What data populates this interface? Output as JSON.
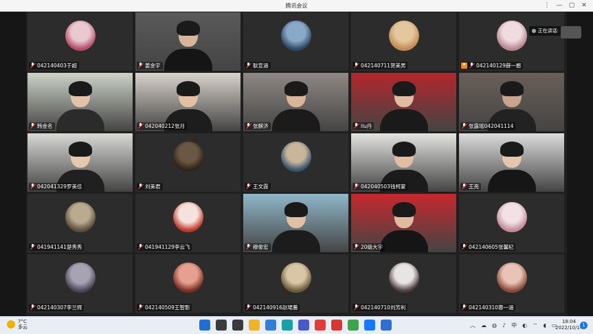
{
  "window": {
    "title": "腾讯会议"
  },
  "speaking_status": "正在讲话:",
  "participants": [
    {
      "name": "042140403于超",
      "kind": "avatar",
      "avatar_colors": [
        "#e8c9cf",
        "#b44d6b"
      ]
    },
    {
      "name": "姜金宇",
      "kind": "video",
      "bg": "#5a5a5a",
      "skin": "#d7b49a",
      "cloth": "#151515"
    },
    {
      "name": "耿宣涵",
      "kind": "avatar",
      "avatar_colors": [
        "#8aa9c9",
        "#2f4a66"
      ]
    },
    {
      "name": "042140711贺美男",
      "kind": "avatar",
      "avatar_colors": [
        "#e5c79d",
        "#c28a55"
      ]
    },
    {
      "name": "042140129薛一憨",
      "kind": "avatar",
      "avatar_colors": [
        "#f0dce0",
        "#b8878f"
      ],
      "host": true
    },
    {
      "name": "韩金名",
      "kind": "video",
      "bg": "#cdd3c7",
      "skin": "#e2c2a8",
      "cloth": "#2b2b2b"
    },
    {
      "name": "042040212张月",
      "kind": "video",
      "bg": "#d8d3cc",
      "skin": "#e2c0a2",
      "cloth": "#1d1d1d"
    },
    {
      "name": "张麒济",
      "kind": "video",
      "bg": "#8f8884",
      "skin": "#d9b59a",
      "cloth": "#1b1b1b"
    },
    {
      "name": "liu丹",
      "kind": "video",
      "bg": "#b3262b",
      "skin": "#e0bca0",
      "cloth": "#1a1a1a"
    },
    {
      "name": "张露瑶042041114",
      "kind": "video",
      "bg": "#6a5f58",
      "skin": "#caa38c",
      "cloth": "#222222"
    },
    {
      "name": "042041329罗美佳",
      "kind": "video",
      "bg": "#d9d9d6",
      "skin": "#e6c8ae",
      "cloth": "#202020"
    },
    {
      "name": "刘美君",
      "kind": "avatar",
      "avatar_colors": [
        "#6b5844",
        "#2e2419"
      ]
    },
    {
      "name": "王文霞",
      "kind": "avatar",
      "avatar_colors": [
        "#c9b69a",
        "#3a5570"
      ]
    },
    {
      "name": "042040503钱柯蒙",
      "kind": "video",
      "bg": "#e3e3e0",
      "skin": "#e1bea2",
      "cloth": "#1b1b1b"
    },
    {
      "name": "王亮",
      "kind": "video",
      "bg": "#dcdcdc",
      "skin": "#e5c6ad",
      "cloth": "#161616"
    },
    {
      "name": "041941141楚秀秀",
      "kind": "avatar",
      "avatar_colors": [
        "#b9ab8f",
        "#5c4f3b"
      ]
    },
    {
      "name": "041941129李云飞",
      "kind": "avatar",
      "avatar_colors": [
        "#f4e3dc",
        "#c0392b"
      ]
    },
    {
      "name": "穆俊宏",
      "kind": "video",
      "bg": "#8fb7c9",
      "skin": "#e0bfa5",
      "cloth": "#1c1c1c"
    },
    {
      "name": "20级大宇",
      "kind": "video",
      "bg": "#c7282e",
      "skin": "#e0bb9e",
      "cloth": "#151515"
    },
    {
      "name": "042140605张馨杞",
      "kind": "avatar",
      "avatar_colors": [
        "#f2e2e6",
        "#c48a98"
      ]
    },
    {
      "name": "042140307李兰辉",
      "kind": "avatar",
      "avatar_colors": [
        "#a7a3b3",
        "#4a4558"
      ]
    },
    {
      "name": "042140509王智影",
      "kind": "avatar",
      "avatar_colors": [
        "#e6a08f",
        "#7a2e26"
      ]
    },
    {
      "name": "042140916赵珺蕙",
      "kind": "avatar",
      "avatar_colors": [
        "#d8c6a6",
        "#6d5b3d"
      ]
    },
    {
      "name": "042140710刘芳利",
      "kind": "avatar",
      "avatar_colors": [
        "#e9e4e4",
        "#4b3f3f"
      ]
    },
    {
      "name": "042140310蓉一涵",
      "kind": "avatar",
      "avatar_colors": [
        "#e9c3b6",
        "#8a4a3c"
      ]
    }
  ],
  "taskbar": {
    "weather_temp": "7°C",
    "weather_desc": "多云",
    "apps": [
      {
        "icon": "windows-start-icon",
        "color": "#1f6fd1"
      },
      {
        "icon": "search-icon",
        "color": "#3b3b3b"
      },
      {
        "icon": "task-view-icon",
        "color": "#3b3b3b"
      },
      {
        "icon": "file-explorer-icon",
        "color": "#f0b429"
      },
      {
        "icon": "mail-icon",
        "color": "#2f7fd6"
      },
      {
        "icon": "edge-browser-icon",
        "color": "#1aa0a8"
      },
      {
        "icon": "store-icon",
        "color": "#4a58c9"
      },
      {
        "icon": "wps-icon",
        "color": "#e23b3b"
      },
      {
        "icon": "wps-office-icon",
        "color": "#d9362f"
      },
      {
        "icon": "chrome-icon",
        "color": "#3ea34b"
      },
      {
        "icon": "meeting-app-icon",
        "color": "#1677ff"
      },
      {
        "icon": "network-app-icon",
        "color": "#2f6fd1"
      }
    ],
    "ime": "中",
    "time": "18:04",
    "date": "2022/10/14",
    "notification_count": "1"
  }
}
